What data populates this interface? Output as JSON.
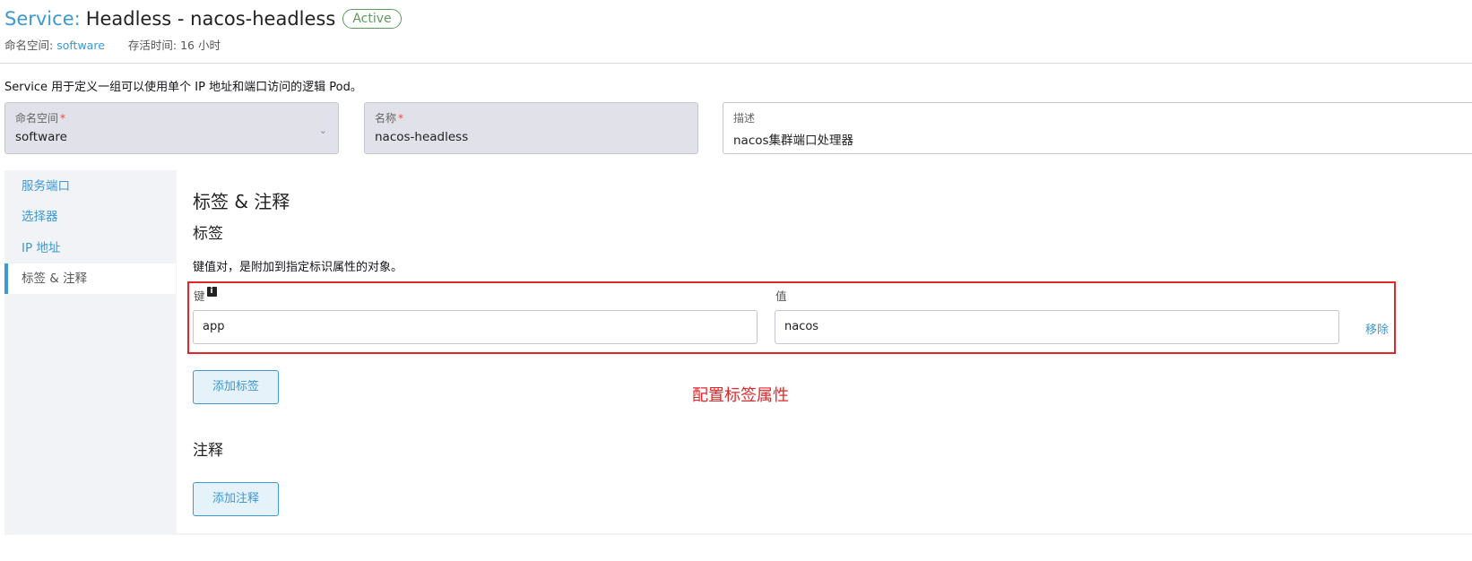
{
  "header": {
    "prefix": "Service:",
    "title": "Headless - nacos-headless",
    "status": "Active"
  },
  "meta": {
    "namespace_label": "命名空间:",
    "namespace_value": "software",
    "age_label": "存活时间:",
    "age_value": "16 小时"
  },
  "description": "Service 用于定义一组可以使用单个 IP 地址和端口访问的逻辑 Pod。",
  "fields": {
    "namespace": {
      "label": "命名空间",
      "required": "*",
      "value": "software"
    },
    "name": {
      "label": "名称",
      "required": "*",
      "value": "nacos-headless"
    },
    "desc": {
      "label": "描述",
      "value": "nacos集群端口处理器"
    }
  },
  "tabs": [
    {
      "label": "服务端口",
      "active": false
    },
    {
      "label": "选择器",
      "active": false
    },
    {
      "label": "IP 地址",
      "active": false
    },
    {
      "label": "标签 & 注释",
      "active": true
    }
  ],
  "content": {
    "section_title": "标签 & 注释",
    "labels_title": "标签",
    "labels_hint": "键值对，是附加到指定标识属性的对象。",
    "key_label": "键",
    "value_label": "值",
    "rows": [
      {
        "key": "app",
        "value": "nacos",
        "remove_label": "移除"
      }
    ],
    "add_label_button": "添加标签",
    "annotations_title": "注释",
    "add_annotation_button": "添加注释"
  },
  "annotation_note": "配置标签属性",
  "colors": {
    "accent": "#3d98d3",
    "active_badge": "#5d995d",
    "highlight": "#e2272b",
    "disabled_field": "#e0e1e9"
  },
  "icons": {
    "info": "info-icon",
    "chevron": "chevron-down-icon"
  }
}
